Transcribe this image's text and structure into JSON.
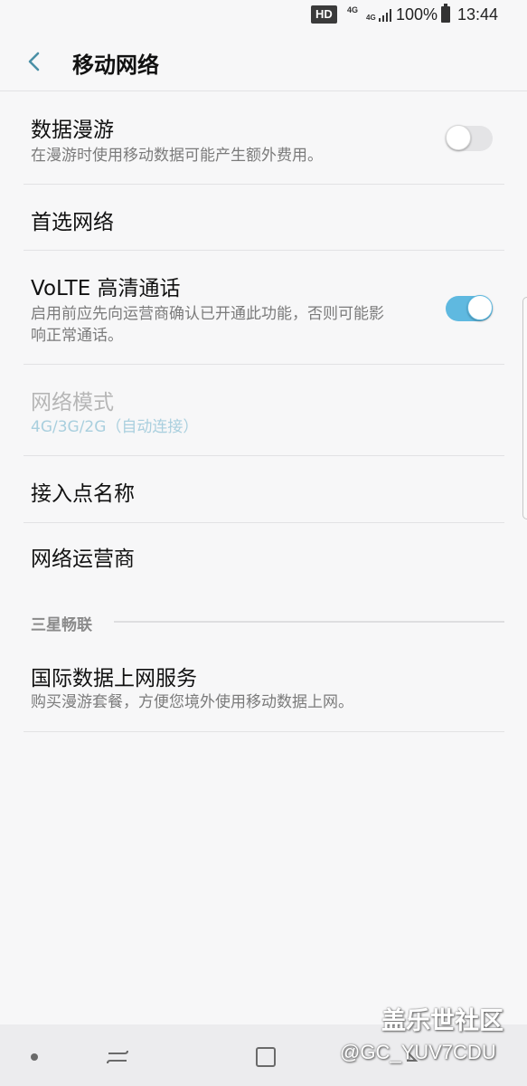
{
  "status_bar": {
    "hd": "HD",
    "net_top": "4G",
    "net_bottom": "4G",
    "battery": "100%",
    "time": "13:44"
  },
  "header": {
    "title": "移动网络",
    "back_icon": "chevron-left-icon"
  },
  "settings": [
    {
      "title": "数据漫游",
      "subtitle": "在漫游时使用移动数据可能产生额外费用。",
      "toggle": "off"
    },
    {
      "title": "首选网络"
    },
    {
      "title": "VoLTE 高清通话",
      "subtitle": "启用前应先向运营商确认已开通此功能，否则可能影响正常通话。",
      "toggle": "on"
    },
    {
      "title": "网络模式",
      "subtitle": "4G/3G/2G（自动连接）",
      "disabled": true
    },
    {
      "title": "接入点名称"
    },
    {
      "title": "网络运营商"
    }
  ],
  "section": {
    "header": "三星畅联",
    "items": [
      {
        "title": "国际数据上网服务",
        "subtitle": "购买漫游套餐，方便您境外使用移动数据上网。"
      }
    ]
  },
  "watermark": {
    "title": "盖乐世社区",
    "id": "@GC_YUV7CDU"
  },
  "colors": {
    "accent": "#5fb9e0",
    "background": "#f7f7f8",
    "back_icon": "#4a90a6"
  }
}
